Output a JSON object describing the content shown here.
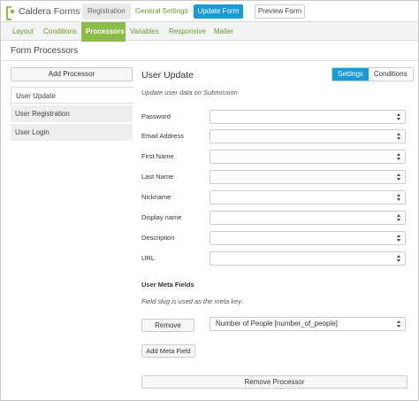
{
  "header": {
    "logo_text": "Caldera Forms",
    "tabs": [
      {
        "label": "Registration"
      },
      {
        "label": "General Settings"
      }
    ],
    "update_button": "Update Form",
    "preview_button": "Preview Form"
  },
  "subnav": {
    "items": [
      {
        "label": "Layout"
      },
      {
        "label": "Conditions"
      },
      {
        "label": "Processors",
        "active": true
      },
      {
        "label": "Variables"
      },
      {
        "label": "Responsive"
      },
      {
        "label": "Mailer"
      }
    ]
  },
  "page": {
    "section_title": "Form Processors"
  },
  "sidebar": {
    "add_button": "Add Processor",
    "items": [
      {
        "label": "User Update",
        "active": true
      },
      {
        "label": "User Registration"
      },
      {
        "label": "User Login"
      }
    ]
  },
  "panel": {
    "title": "User Update",
    "toggle": {
      "settings": "Settings",
      "conditions": "Conditions"
    },
    "description": "Update user data on Submission",
    "fields": [
      {
        "label": "Password",
        "value": ""
      },
      {
        "label": "Email Address",
        "value": ""
      },
      {
        "label": "First Name",
        "value": ""
      },
      {
        "label": "Last Name",
        "value": ""
      },
      {
        "label": "Nickname",
        "value": ""
      },
      {
        "label": "Display name",
        "value": ""
      },
      {
        "label": "Description",
        "value": ""
      },
      {
        "label": "URL",
        "value": ""
      }
    ],
    "meta": {
      "heading": "User Meta Fields",
      "note": "Field slug is used as the meta key.",
      "remove_button": "Remove",
      "selected_field": "Number of People [number_of_people]",
      "add_button": "Add Meta Field"
    },
    "remove_processor": "Remove Processor"
  },
  "colors": {
    "accent_green": "#8dbb48",
    "link_green": "#6a9a2a",
    "primary_blue": "#1a9ad6"
  }
}
